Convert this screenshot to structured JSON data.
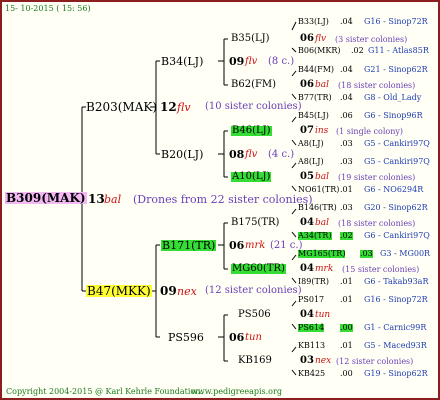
{
  "header": {
    "date": "15- 10-2015 ( 15: 56)"
  },
  "footer": {
    "copyright": "Copyright 2004-2015 @ Karl Kehrle Foundation.",
    "site": "www.pedigreeapis.org"
  },
  "root": {
    "id": "B309(MAK)",
    "num": "13",
    "type": "bal",
    "note": "(Drones from 22 sister colonies)"
  },
  "gen1": {
    "top": {
      "id": "B203(MAK)",
      "num": "12",
      "type": "flv",
      "note": "(10 sister colonies)"
    },
    "bottom": {
      "id": "B47(MKK)",
      "num": "09",
      "type": "nex",
      "note": "(12 sister colonies)"
    }
  },
  "gen2": {
    "a": {
      "id": "B34(LJ)",
      "num": "09",
      "type": "flv",
      "note": "(8 c.)"
    },
    "b": {
      "id": "B20(LJ)",
      "num": "08",
      "type": "flv",
      "note": "(4 c.)"
    },
    "c": {
      "id": "B171(TR)",
      "num": "06",
      "type": "mrk",
      "note": "(21 c.)"
    },
    "d": {
      "id": "PS596",
      "num": "06",
      "type": "tun"
    }
  },
  "gen3": {
    "a": {
      "id": "B35(LJ)",
      "num": "06",
      "type": "flv",
      "note": "(3 sister colonies)"
    },
    "b": {
      "id": "B62(FM)",
      "num": "06",
      "type": "bal",
      "note": "(18 sister colonies)"
    },
    "c": {
      "id": "B46(LJ)",
      "num": "07",
      "type": "ins",
      "note": "(1 single colony)"
    },
    "d": {
      "id": "A10(LJ)",
      "num": "05",
      "type": "bal",
      "note": "(19 sister colonies)"
    },
    "e": {
      "id": "B175(TR)",
      "num": "04",
      "type": "bal",
      "note": "(18 sister colonies)"
    },
    "f": {
      "id": "MG60(TR)",
      "num": "04",
      "type": "mrk",
      "note": "(15 sister colonies)"
    },
    "g": {
      "id": "PS506",
      "num": "04",
      "type": "tun"
    },
    "h": {
      "id": "KB169",
      "num": "03",
      "type": "nex",
      "note": "(12 sister colonies)"
    }
  },
  "gen4": [
    {
      "id": "B33(LJ)",
      "val": ".04",
      "code": "G16 - Sinop72R"
    },
    {
      "id": "B06(MKR)",
      "val": ".02",
      "code": "G11 - Atlas85R"
    },
    {
      "id": "B44(FM)",
      "val": ".04",
      "code": "G21 - Sinop62R"
    },
    {
      "id": "B77(TR)",
      "val": ".04",
      "code": "G8 - Old_Lady"
    },
    {
      "id": "B45(LJ)",
      "val": ".06",
      "code": "G6 - Sinop96R"
    },
    {
      "id": "A8(LJ)",
      "val": ".03",
      "code": "G5 - Cankiri97Q"
    },
    {
      "id": "A8(LJ)",
      "val": ".03",
      "code": "G5 - Cankiri97Q"
    },
    {
      "id": "NO61(TR)",
      "val": ".01",
      "code": "G6 - NO6294R"
    },
    {
      "id": "B146(TR)",
      "val": ".03",
      "code": "G20 - Sinop62R"
    },
    {
      "id": "A34(TR)",
      "val": ".02",
      "code": "G6 - Cankiri97Q"
    },
    {
      "id": "MG165(TR)",
      "val": ".03",
      "code": "G3 - MG00R"
    },
    {
      "id": "I89(TR)",
      "val": ".01",
      "code": "G6 - Takab93aR"
    },
    {
      "id": "PS017",
      "val": ".01",
      "code": "G16 - Sinop72R"
    },
    {
      "id": "PS614",
      "val": ".00",
      "code": "G1 - Carnic99R"
    },
    {
      "id": "KB113",
      "val": ".01",
      "code": "G5 - Maced93R"
    },
    {
      "id": "KB425",
      "val": ".00",
      "code": "G19 - Sinop62R"
    }
  ],
  "colors": {
    "border": "#8b1f1f",
    "root_highlight": "#f2b8f2",
    "green_highlight": "#33dd33",
    "yellow_highlight": "#ffff33",
    "line": "#000000"
  }
}
